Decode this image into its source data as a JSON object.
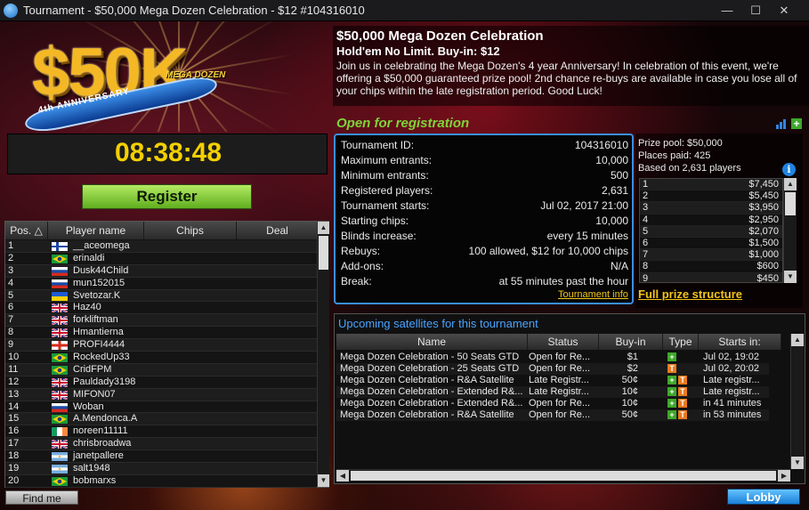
{
  "window": {
    "title": "Tournament - $50,000 Mega Dozen Celebration - $12 #104316010",
    "min": "—",
    "max": "☐",
    "close": "✕"
  },
  "banner": {
    "amount": "$50K",
    "anniversary": "4th ANNIVERSARY",
    "brand": "MEGA DOZEN"
  },
  "clock": "08:38:48",
  "register_label": "Register",
  "players": {
    "columns": [
      "Pos.",
      "Player name",
      "Chips",
      "Deal"
    ],
    "rows": [
      {
        "pos": "1",
        "name": "__aceomega",
        "flag": "fi"
      },
      {
        "pos": "2",
        "name": "erinaldi",
        "flag": "br"
      },
      {
        "pos": "3",
        "name": "Dusk44Child",
        "flag": "ru"
      },
      {
        "pos": "4",
        "name": "mun152015",
        "flag": "ru"
      },
      {
        "pos": "5",
        "name": "Svetozar.K",
        "flag": "ua"
      },
      {
        "pos": "6",
        "name": "Haz40",
        "flag": "gb"
      },
      {
        "pos": "7",
        "name": "forkliftman",
        "flag": "gb"
      },
      {
        "pos": "8",
        "name": "Hmantierna",
        "flag": "gb"
      },
      {
        "pos": "9",
        "name": "PROFI4444",
        "flag": "ge"
      },
      {
        "pos": "10",
        "name": "RockedUp33",
        "flag": "br"
      },
      {
        "pos": "11",
        "name": "CridFPM",
        "flag": "br"
      },
      {
        "pos": "12",
        "name": "Pauldady3198",
        "flag": "gb"
      },
      {
        "pos": "13",
        "name": "MIFON07",
        "flag": "gb"
      },
      {
        "pos": "14",
        "name": "Woban",
        "flag": "ru"
      },
      {
        "pos": "15",
        "name": "A.Mendonca.A",
        "flag": "br"
      },
      {
        "pos": "16",
        "name": "noreen11111",
        "flag": "ie"
      },
      {
        "pos": "17",
        "name": "chrisbroadwa",
        "flag": "gb"
      },
      {
        "pos": "18",
        "name": "janetpallere",
        "flag": "ar"
      },
      {
        "pos": "19",
        "name": "salt1948",
        "flag": "ar"
      },
      {
        "pos": "20",
        "name": "bobmarxs",
        "flag": "br"
      }
    ]
  },
  "find_me_label": "Find me",
  "lobby_label": "Lobby",
  "tournament": {
    "title": "$50,000 Mega Dozen Celebration",
    "subtitle": "Hold'em No Limit. Buy-in: $12",
    "description": "Join us in celebrating the Mega Dozen's 4 year Anniversary! In celebration of this event, we're offering a $50,000 guaranteed prize pool! 2nd chance re-buys are available in case you lose all of your chips within the late registration period. Good Luck!",
    "status": "Open for registration"
  },
  "details": [
    {
      "label": "Tournament ID:",
      "value": "104316010"
    },
    {
      "label": "Maximum entrants:",
      "value": "10,000"
    },
    {
      "label": "Minimum entrants:",
      "value": "500"
    },
    {
      "label": "Registered players:",
      "value": "2,631"
    },
    {
      "label": "Tournament starts:",
      "value": "Jul 02, 2017 21:00"
    },
    {
      "label": "Starting chips:",
      "value": "10,000"
    },
    {
      "label": "Blinds increase:",
      "value": "every 15 minutes"
    },
    {
      "label": "Rebuys:",
      "value": "100 allowed, $12 for 10,000 chips"
    },
    {
      "label": "Add-ons:",
      "value": "N/A"
    },
    {
      "label": "Break:",
      "value": "at 55 minutes past the hour"
    }
  ],
  "tournament_info_link": "Tournament info",
  "prize": {
    "pool": "Prize pool: $50,000",
    "places": "Places paid: 425",
    "based": "Based on 2,631 players",
    "rows": [
      {
        "place": "1",
        "amount": "$7,450"
      },
      {
        "place": "2",
        "amount": "$5,450"
      },
      {
        "place": "3",
        "amount": "$3,950"
      },
      {
        "place": "4",
        "amount": "$2,950"
      },
      {
        "place": "5",
        "amount": "$2,070"
      },
      {
        "place": "6",
        "amount": "$1,500"
      },
      {
        "place": "7",
        "amount": "$1,000"
      },
      {
        "place": "8",
        "amount": "$600"
      },
      {
        "place": "9",
        "amount": "$450"
      }
    ],
    "full_link": "Full prize structure"
  },
  "satellites": {
    "title": "Upcoming satellites for this tournament",
    "columns": [
      "Name",
      "Status",
      "Buy-in",
      "Type",
      "Starts in:"
    ],
    "rows": [
      {
        "name": "Mega Dozen Celebration - 50 Seats GTD",
        "status": "Open for Re...",
        "buyin": "$1",
        "types": [
          "plus"
        ],
        "starts": "Jul 02, 19:02"
      },
      {
        "name": "Mega Dozen Celebration - 25 Seats GTD",
        "status": "Open for Re...",
        "buyin": "$2",
        "types": [
          "t"
        ],
        "starts": "Jul 02, 20:02"
      },
      {
        "name": "Mega Dozen Celebration - R&A Satellite",
        "status": "Late Registr...",
        "buyin": "50¢",
        "types": [
          "plus",
          "t"
        ],
        "starts": "Late registr..."
      },
      {
        "name": "Mega Dozen Celebration - Extended R&...",
        "status": "Late Registr...",
        "buyin": "10¢",
        "types": [
          "plus",
          "t"
        ],
        "starts": "Late registr..."
      },
      {
        "name": "Mega Dozen Celebration - Extended R&...",
        "status": "Open for Re...",
        "buyin": "10¢",
        "types": [
          "plus",
          "t"
        ],
        "starts": "in 41 minutes"
      },
      {
        "name": "Mega Dozen Celebration - R&A Satellite",
        "status": "Open for Re...",
        "buyin": "50¢",
        "types": [
          "plus",
          "t"
        ],
        "starts": "in 53 minutes"
      }
    ]
  },
  "colors": {
    "accent_green": "#7fd33b",
    "clock_yellow": "#f4d000",
    "link_gold": "#f0c419",
    "lobby_blue": "#1a7fd8"
  }
}
